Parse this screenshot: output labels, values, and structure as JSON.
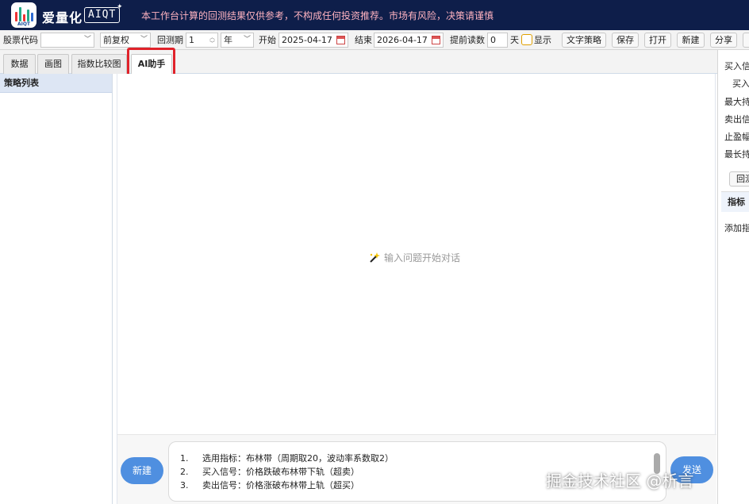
{
  "header": {
    "brand": "爱量化",
    "logo_text": "AIQT",
    "aiqt_badge": "AIQT",
    "notice": "本工作台计算的回测结果仅供参考，不构成任何投资推荐。市场有风险，决策请谨慎"
  },
  "toolbar": {
    "stock_code_label": "股票代码",
    "stock_code_value": "",
    "adjust_value": "前复权",
    "period_label": "回测期",
    "period_value": "1",
    "period_unit": "年",
    "start_label": "开始",
    "start_date": "2025-04-17",
    "end_label": "结束",
    "end_date": "2026-04-17",
    "advance_label": "提前读数",
    "advance_value": "0",
    "day_label": "天",
    "show_label": "显示",
    "text_strategy": "文字策略",
    "save": "保存",
    "open": "打开",
    "new": "新建",
    "share": "分享"
  },
  "tabs": [
    "数据",
    "画图",
    "指数比较图",
    "AI助手"
  ],
  "left_panel": {
    "title": "策略列表"
  },
  "chat": {
    "empty_hint": "输入问题开始对话",
    "new_button": "新建",
    "send_button": "发送",
    "input_lines": [
      {
        "num": "1.",
        "text": "选用指标：布林带（周期取20，波动率系数取2）"
      },
      {
        "num": "2.",
        "text": "买入信号：价格跌破布林带下轨（超卖）"
      },
      {
        "num": "3.",
        "text": "卖出信号：价格涨破布林带上轨（超买）"
      }
    ]
  },
  "right_panel": {
    "items": [
      "买入信",
      "买入",
      "最大持",
      "卖出信",
      "止盈幅",
      "最长持"
    ],
    "backtest_btn": "回测",
    "indicator_tab": "指标",
    "add_indicator": "添加指"
  },
  "watermark": "掘金技术社区 @析言"
}
